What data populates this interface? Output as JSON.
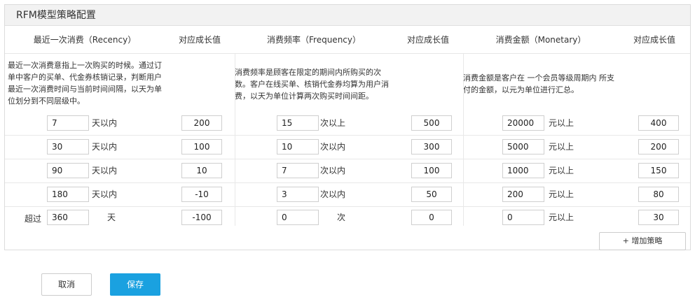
{
  "panel": {
    "title": "RFM模型策略配置"
  },
  "headers": {
    "recency": "最近一次消费（Recency）",
    "recency_value": "对应成长值",
    "frequency": "消费频率（Frequency）",
    "frequency_value": "对应成长值",
    "monetary": "消费金额（Monetary）",
    "monetary_value": "对应成长值"
  },
  "descriptions": {
    "recency": "最近一次消费意指上一次购买的时候。通过订单中客户的买单、代金券核销记录，判断用户最近一次消费时间与当前时间间隔，以天为单位划分到不同层级中。",
    "frequency": "消费频率是顾客在限定的期间内所购买的次数。客户在线买单、核销代金券均算为用户消费，以天为单位计算两次购买时间间距。",
    "monetary": "消费金额是客户在 一个会员等级周期内 所支付的金额，以元为单位进行汇总。"
  },
  "rows": [
    {
      "prefix": "",
      "r": "7",
      "r_unit": "天以内",
      "r_val": "200",
      "f": "15",
      "f_unit": "次以上",
      "f_val": "500",
      "m": "20000",
      "m_unit": "元以上",
      "m_val": "400"
    },
    {
      "prefix": "",
      "r": "30",
      "r_unit": "天以内",
      "r_val": "100",
      "f": "10",
      "f_unit": "次以内",
      "f_val": "300",
      "m": "5000",
      "m_unit": "元以上",
      "m_val": "200"
    },
    {
      "prefix": "",
      "r": "90",
      "r_unit": "天以内",
      "r_val": "10",
      "f": "7",
      "f_unit": "次以内",
      "f_val": "100",
      "m": "1000",
      "m_unit": "元以上",
      "m_val": "150"
    },
    {
      "prefix": "",
      "r": "180",
      "r_unit": "天以内",
      "r_val": "-10",
      "f": "3",
      "f_unit": "次以内",
      "f_val": "50",
      "m": "200",
      "m_unit": "元以上",
      "m_val": "80"
    },
    {
      "prefix": "超过",
      "r": "360",
      "r_unit": "天",
      "r_val": "-100",
      "f": "0",
      "f_unit": "次",
      "f_val": "0",
      "m": "0",
      "m_unit": "元以上",
      "m_val": "30"
    }
  ],
  "actions": {
    "add_strategy": "+ 增加策略",
    "cancel": "取消",
    "save": "保存"
  }
}
